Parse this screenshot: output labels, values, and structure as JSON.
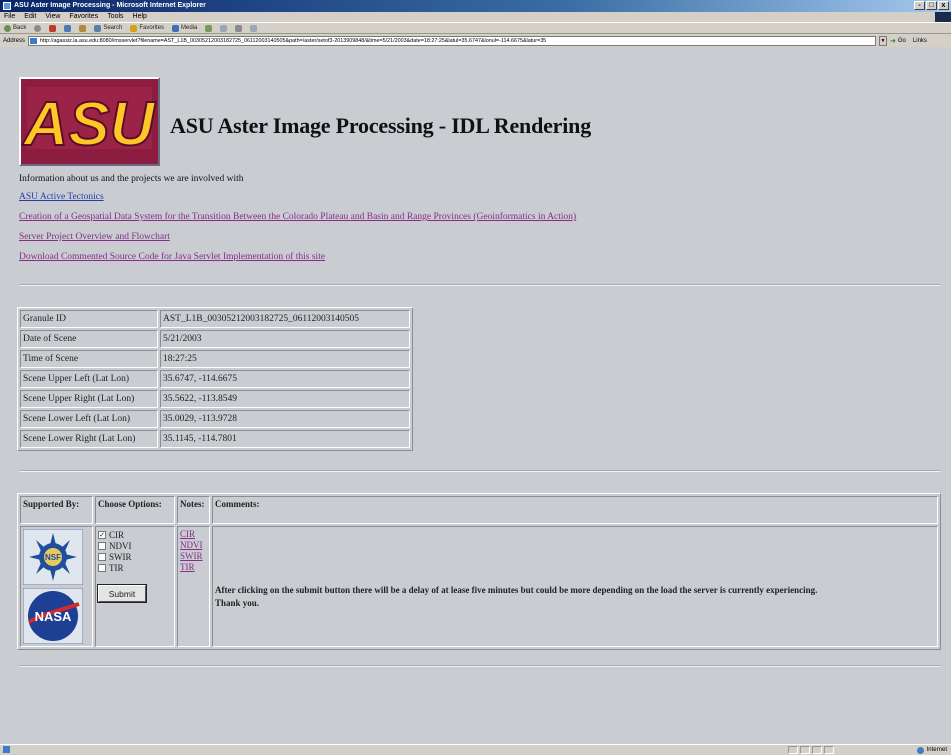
{
  "window": {
    "title": "ASU Aster Image Processing - Microsoft Internet Explorer",
    "controls": [
      "-",
      "□",
      "x"
    ]
  },
  "menu": [
    "File",
    "Edit",
    "View",
    "Favorites",
    "Tools",
    "Help"
  ],
  "toolbar": {
    "back": "Back",
    "search": "Search",
    "favorites": "Favorites",
    "media": "Media"
  },
  "address": {
    "label": "Address",
    "url": "http://agassiz.la.asu.edu:8080/imsservlet?filename=AST_L1B_00305212003182725_06112003140505&path=/aster/setof3-2013909848/&time=5/21/2003&date=18:27:25&latul=35.6747&lonul=-114.6675&latur=35",
    "go": "Go",
    "links": "Links"
  },
  "page": {
    "logo_text": "ASU",
    "title": "ASU Aster Image Processing - IDL Rendering",
    "intro": "Information about us and the projects we are involved with",
    "links": [
      {
        "label": "ASU Active Tectonics",
        "color": "blue"
      },
      {
        "label": "Creation of a Geospatial Data System for the Transition Between the Colorado Plateau and Basin and Range Provinces (Geoinformatics in Action)",
        "color": "purple"
      },
      {
        "label": "Server Project Overview and Flowchart",
        "color": "purple"
      },
      {
        "label": "Download Commented Source Code for Java Servlet Implementation of this site",
        "color": "purple"
      }
    ],
    "info": [
      {
        "key": "Granule ID",
        "value": "AST_L1B_00305212003182725_06112003140505"
      },
      {
        "key": "Date of Scene",
        "value": "5/21/2003"
      },
      {
        "key": "Time of Scene",
        "value": "18:27:25"
      },
      {
        "key": "Scene Upper Left (Lat Lon)",
        "value": "35.6747, -114.6675"
      },
      {
        "key": "Scene Upper Right (Lat Lon)",
        "value": "35.5622, -113.8549"
      },
      {
        "key": "Scene Lower Left (Lat Lon)",
        "value": "35.0029, -113.9728"
      },
      {
        "key": "Scene Lower Right (Lat Lon)",
        "value": "35.1145, -114.7801"
      }
    ],
    "options_table": {
      "headers": [
        "Supported By:",
        "Choose Options:",
        "Notes:",
        "Comments:"
      ],
      "logos": [
        "NSF",
        "NASA"
      ],
      "options": [
        {
          "label": "CIR",
          "checked": true
        },
        {
          "label": "NDVI",
          "checked": false
        },
        {
          "label": "SWIR",
          "checked": false
        },
        {
          "label": "TIR",
          "checked": false
        }
      ],
      "notes": [
        "CIR",
        "NDVI",
        "SWIR",
        "TIR"
      ],
      "submit": "Submit",
      "comment": "After clicking on the submit button there will be a delay of at lease five minutes but could be more depending on the load the server is currently experiencing.",
      "thanks": "Thank you."
    }
  },
  "status": {
    "zone": "Internet"
  },
  "colors": {
    "page_bg": "#c9cdd2",
    "asu_maroon": "#8c1d40",
    "asu_gold": "#ffc627",
    "link_blue": "#2a3aa8",
    "link_visited": "#8a2a8a"
  }
}
